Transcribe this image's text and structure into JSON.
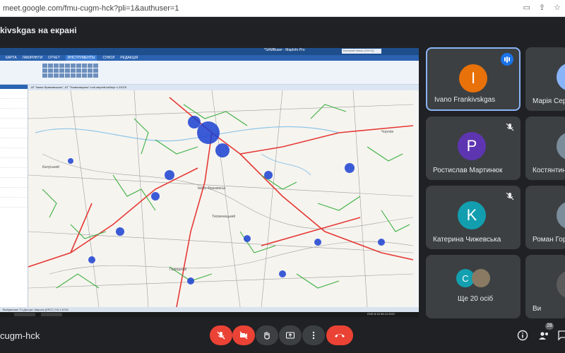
{
  "browser": {
    "url": "meet.google.com/fmu-cugm-hck?pli=1&authuser=1"
  },
  "meeting": {
    "presenting_title": "kivskgas на екрані",
    "bottom_code": "cugm-hck",
    "participants_count": "28"
  },
  "shared_app": {
    "window_title": "*SAMBuser - MapInfo Pro",
    "search_placeholder": "Быстрый поиск (Ctrl+Q)",
    "ribbon_tabs": [
      "КАРТА",
      "ЛАБІРИНТИ",
      "ОТЧЕТ",
      "ИНСТРУМЕНТЫ",
      "СУВОЛ",
      "РЕДАКЦІЯ"
    ],
    "active_ribbon_tab": "ИНСТРУМЕНТЫ",
    "map_tab_label": "АТ \"Івано-Франківськгаз\", АТ \"Тисменицягаз\" слої.мергей.кабінут х.24378",
    "status_text": "Выбранные ТЧ  Доступ: Широта  (ЕРСГ)  ПЧ  1:5700",
    "clock_time": "8:15",
    "clock_date": "06.12.2022",
    "lang": "ENG",
    "map_labels": [
      "Калуський",
      "Івано-Франківськ",
      "Тисменицький",
      "Чортків",
      "Галицький"
    ]
  },
  "tiles": [
    {
      "name": "Ivano Frankivskgas",
      "initial": "I",
      "color": "#e8710a",
      "speaking": true
    },
    {
      "name": "Марія Сергіївна",
      "initial": "М",
      "color": "#8ab4f8",
      "speaking": false
    },
    {
      "name": "Ростислав Мартинюк",
      "initial": "P",
      "color": "#5e35b1",
      "muted": true
    },
    {
      "name": "Костянтин",
      "initial": "К",
      "color": "#7b8c9a",
      "muted": true
    },
    {
      "name": "Катерина Чижевська",
      "initial": "K",
      "color": "#129eaf",
      "muted": true
    },
    {
      "name": "Роман Гор",
      "initial": "Р",
      "color": "#7b8c9a",
      "muted": true
    },
    {
      "name": "Ще 20 осіб",
      "initial": "C",
      "color": "#12a0b0"
    },
    {
      "name": "Ви",
      "initial": "",
      "color": "#5b5b5b"
    }
  ],
  "controls": [
    "mic-off",
    "camera-off",
    "raise-hand",
    "present",
    "more",
    "leave"
  ],
  "colors": {
    "meet_bg": "#202124",
    "tile_bg": "#3c4043",
    "red": "#ea4335",
    "blue": "#1a73e8"
  }
}
